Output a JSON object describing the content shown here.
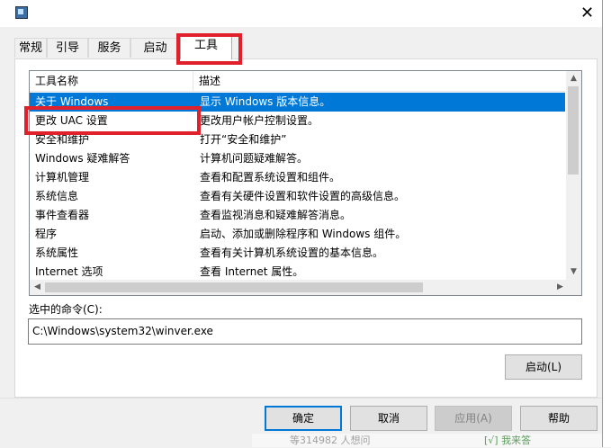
{
  "window": {
    "close_glyph": "✕"
  },
  "tabs": [
    {
      "label": "常规"
    },
    {
      "label": "引导"
    },
    {
      "label": "服务"
    },
    {
      "label": "启动"
    },
    {
      "label": "工具"
    }
  ],
  "list": {
    "columns": [
      "工具名称",
      "描述"
    ],
    "rows": [
      {
        "name": "关于 Windows",
        "desc": "显示 Windows 版本信息。",
        "selected": true
      },
      {
        "name": "更改 UAC 设置",
        "desc": "更改用户帐户控制设置。"
      },
      {
        "name": "安全和维护",
        "desc": "打开“安全和维护”"
      },
      {
        "name": "Windows 疑难解答",
        "desc": "计算机问题疑难解答。"
      },
      {
        "name": "计算机管理",
        "desc": "查看和配置系统设置和组件。"
      },
      {
        "name": "系统信息",
        "desc": "查看有关硬件设置和软件设置的高级信息。"
      },
      {
        "name": "事件查看器",
        "desc": "查看监视消息和疑难解答消息。"
      },
      {
        "name": "程序",
        "desc": "启动、添加或删除程序和 Windows 组件。"
      },
      {
        "name": "系统属性",
        "desc": "查看有关计算机系统设置的基本信息。"
      },
      {
        "name": "Internet 选项",
        "desc": "查看 Internet 属性。"
      }
    ]
  },
  "command": {
    "label": "选中的命令(C):",
    "value": "C:\\Windows\\system32\\winver.exe"
  },
  "buttons": {
    "launch": "启动(L)",
    "ok": "确定",
    "cancel": "取消",
    "apply": "应用(A)",
    "help": "帮助"
  },
  "background": {
    "text_left": "等314982 人想问",
    "text_right": "[√] 我来答"
  },
  "colors": {
    "selection": "#0078d7",
    "highlight_box": "#e0202a"
  }
}
